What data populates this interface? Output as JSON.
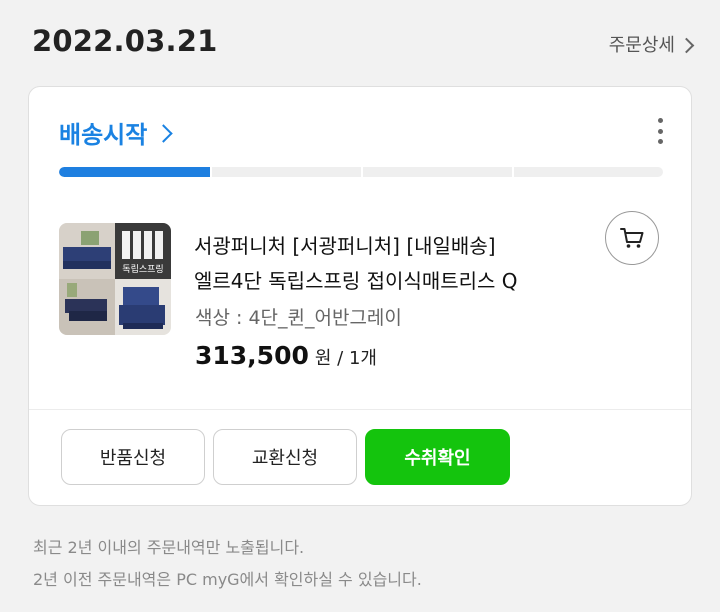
{
  "order": {
    "date": "2022.03.21",
    "detail_link": "주문상세"
  },
  "card": {
    "status_label": "배송시작",
    "more_icon": "more-vert-icon",
    "progress": {
      "value": 0.25,
      "fill_color": "#1e7fe0",
      "steps": 4
    },
    "product": {
      "name": "서광퍼니처 [서광퍼니처] [내일배송] 엘르4단 독립스프링 접이식매트리스 Q",
      "option": "색상 : 4단_퀸_어반그레이",
      "price": "313,500",
      "price_unit": "원 / 1개",
      "thumbnail_icon": "product-image",
      "thumbnail_text": "독립스프링",
      "cart_icon": "cart-icon"
    },
    "actions": {
      "return": "반품신청",
      "exchange": "교환신청",
      "confirm": "수취확인"
    }
  },
  "notice": {
    "line1": "최근 2년 이내의 주문내역만 노출됩니다.",
    "line2": "2년 이전 주문내역은 PC myG에서 확인하실 수 있습니다."
  }
}
